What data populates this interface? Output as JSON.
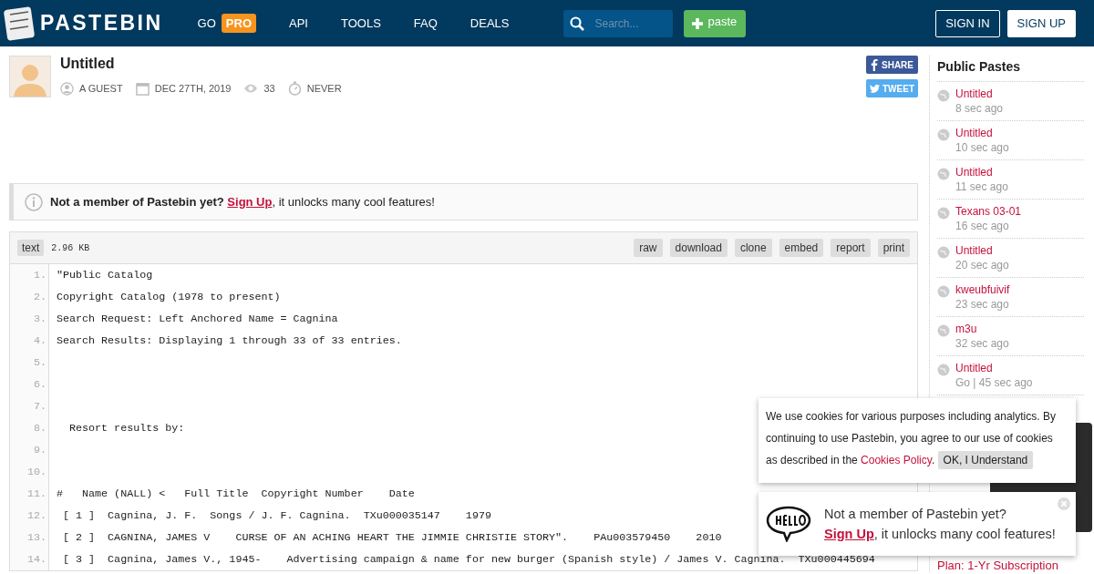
{
  "header": {
    "logo": "PASTEBIN",
    "nav": [
      {
        "label": "GO",
        "badge": "PRO"
      },
      {
        "label": "API"
      },
      {
        "label": "TOOLS"
      },
      {
        "label": "FAQ"
      },
      {
        "label": "DEALS"
      }
    ],
    "search": {
      "placeholder": "Search..."
    },
    "paste_button": "paste",
    "sign_in": "SIGN IN",
    "sign_up": "SIGN UP"
  },
  "paste": {
    "title": "Untitled",
    "author": "A GUEST",
    "date": "DEC 27TH, 2019",
    "views": "33",
    "expires": "NEVER",
    "share": "SHARE",
    "tweet": "TWEET"
  },
  "notice": {
    "lead": "Not a member of Pastebin yet?",
    "link": "Sign Up",
    "rest": ", it unlocks many cool features!"
  },
  "code": {
    "syntax": "text",
    "size": "2.96 KB",
    "actions": [
      "raw",
      "download",
      "clone",
      "embed",
      "report",
      "print"
    ],
    "lines": [
      {
        "number": "1.",
        "text": "\"Public Catalog"
      },
      {
        "number": "2.",
        "text": "Copyright Catalog (1978 to present)"
      },
      {
        "number": "3.",
        "text": "Search Request: Left Anchored Name = Cagnina"
      },
      {
        "number": "4.",
        "text": "Search Results: Displaying 1 through 33 of 33 entries."
      },
      {
        "number": "5."
      },
      {
        "number": "6."
      },
      {
        "number": "7."
      },
      {
        "number": "8.",
        "text": "  Resort results by:"
      },
      {
        "number": "9."
      },
      {
        "number": "10."
      },
      {
        "number": "11.",
        "text": "#   Name (NALL) <   Full Title  Copyright Number    Date"
      },
      {
        "number": "12.",
        "text": " [ 1 ]  Cagnina, J. F.  Songs / J. F. Cagnina.  TXu000035147    1979"
      },
      {
        "number": "13.",
        "text": " [ 2 ]  CAGNINA, JAMES V    CURSE OF AN ACHING HEART THE JIMMIE CHRISTIE STORY\".    PAu003579450    2010"
      },
      {
        "number": "14.",
        "text": " [ 3 ]  Cagnina, James V., 1945-    Advertising campaign & name for new burger (Spanish style) / James V. Cagnina.  TXu000445694"
      }
    ]
  },
  "sidebar": {
    "title": "Public Pastes",
    "items": [
      {
        "title": "Untitled",
        "time": "8 sec ago"
      },
      {
        "title": "Untitled",
        "time": "10 sec ago"
      },
      {
        "title": "Untitled",
        "time": "11 sec ago"
      },
      {
        "title": "Texans 03-01",
        "time": "16 sec ago"
      },
      {
        "title": "Untitled",
        "time": "20 sec ago"
      },
      {
        "title": "kweubfuivif",
        "time": "23 sec ago"
      },
      {
        "title": "m3u",
        "time": "32 sec ago"
      },
      {
        "title": "Untitled",
        "time": "Go | 45 sec ago"
      }
    ],
    "plan": "Plan: 1-Yr Subscription"
  },
  "cookie_popup": {
    "text": "We use cookies for various purposes including analytics. By continuing to use Pastebin, you agree to our use of cookies as described in the ",
    "link": "Cookies Policy",
    "after_link": ".",
    "button": "OK, I Understand"
  },
  "hello_popup": {
    "lead": "Not a member of Pastebin yet?",
    "link": "Sign Up",
    "rest": ", it unlocks many cool features!"
  }
}
